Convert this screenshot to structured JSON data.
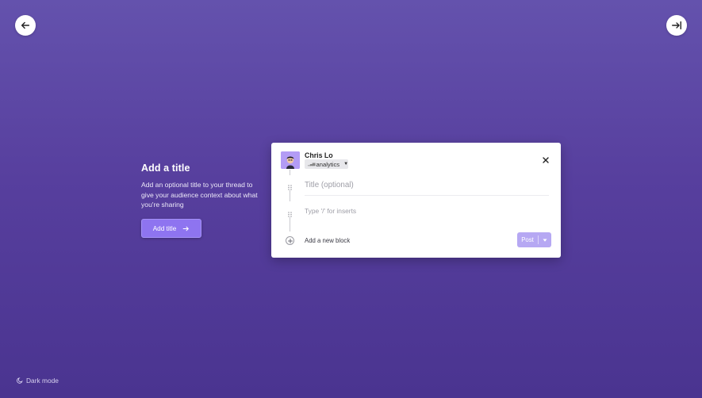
{
  "intro": {
    "heading": "Add a title",
    "description": "Add an optional title to your thread to give your audience context about what you're sharing",
    "button_label": "Add title"
  },
  "composer": {
    "author": "Chris Lo",
    "tag": "analytics",
    "title_placeholder": "Title (optional)",
    "body_placeholder": "Type '/' for inserts",
    "add_block_label": "Add a new block",
    "post_label": "Post"
  },
  "footer": {
    "dark_mode_label": "Dark mode"
  },
  "colors": {
    "background_top": "#6452ad",
    "background_bottom": "#4a3490",
    "accent": "#8e74f0",
    "post_disabled": "#b6a8f3"
  },
  "icons": {
    "back": "arrow-left-icon",
    "collapse": "arrow-right-to-line-icon",
    "close": "close-icon",
    "add_block": "plus-circle-icon",
    "dark_mode": "moon-icon"
  }
}
